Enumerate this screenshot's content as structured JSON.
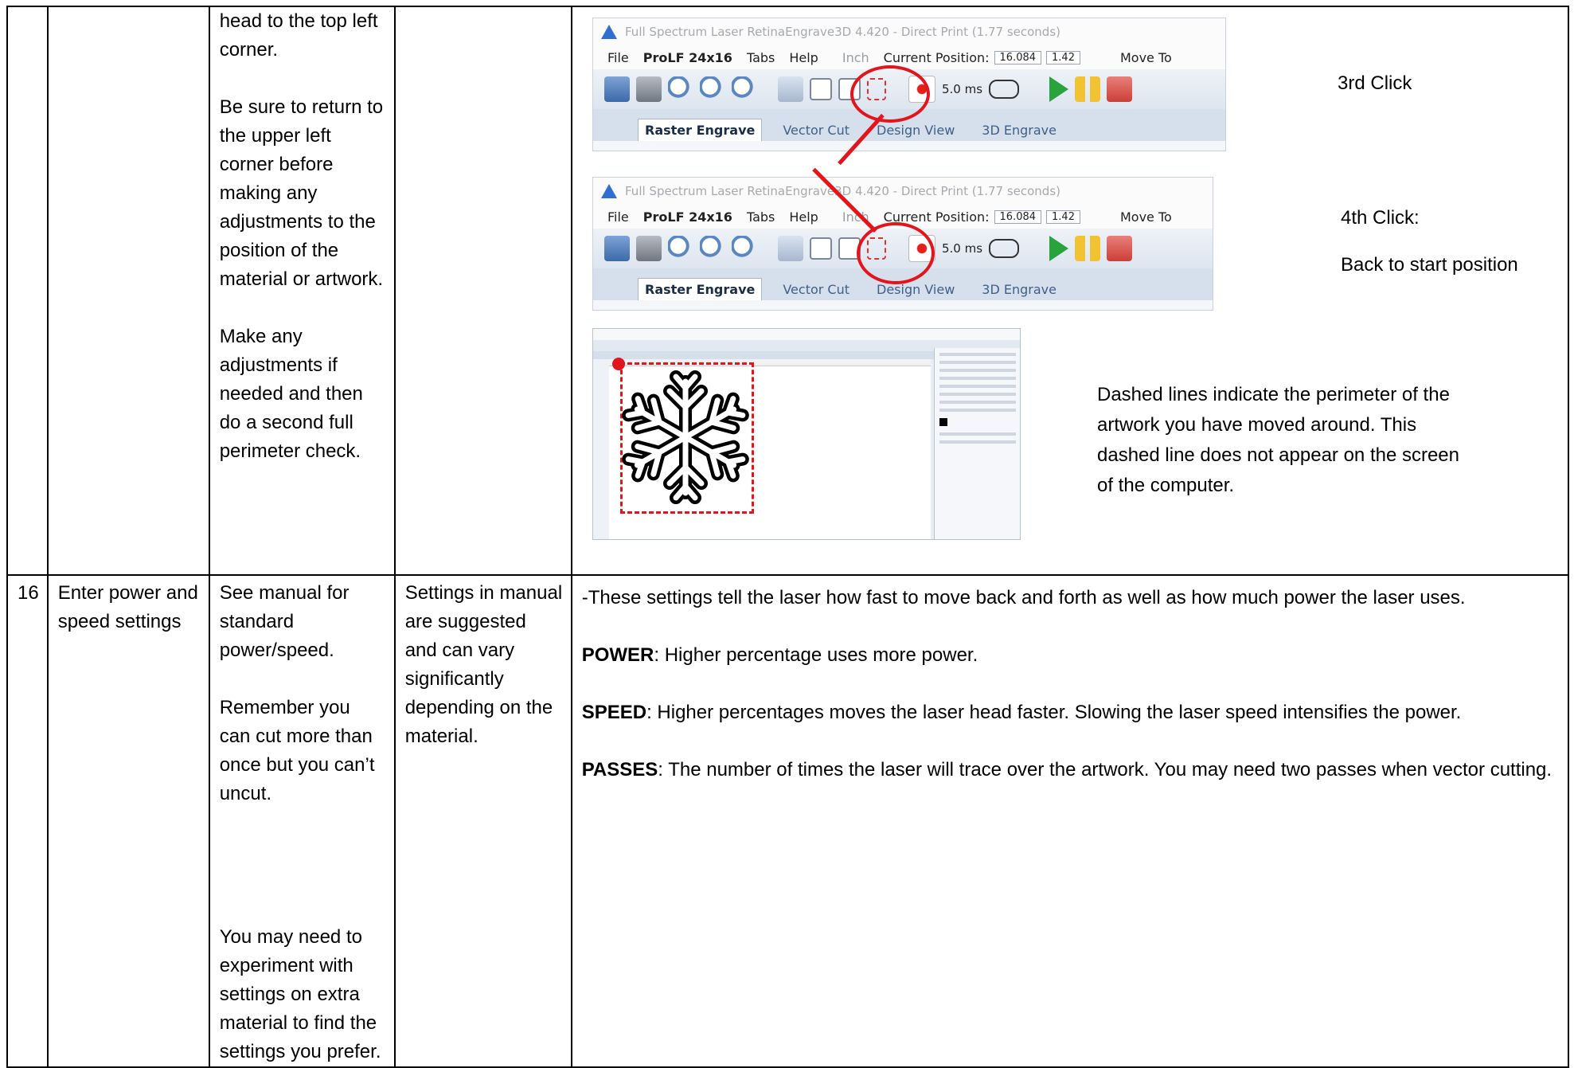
{
  "row_top": {
    "step_continued": [
      "head to the top left corner.",
      "Be sure to return to the upper left corner before making any adjustments to the position of the material or artwork.",
      "Make any adjustments if needed and then do a second full perimeter check."
    ],
    "callouts": {
      "third_click": "3rd Click",
      "fourth_click": "4th Click:",
      "back_to_start": "Back to start position",
      "dashed_note": "Dashed lines indicate the perimeter of the artwork you have moved around. This dashed line does not appear on the screen of the computer."
    },
    "screenshot": {
      "window_title": "Full Spectrum Laser RetinaEngrave3D 4.420 - Direct Print (1.77 seconds)",
      "menu": [
        "File",
        "ProLF 24x16",
        "Tabs",
        "Help"
      ],
      "unit": "Inch",
      "current_position_label": "Current Position:",
      "pos_x": "16.084",
      "pos_y": "1.42",
      "move_to": "Move To",
      "dwell": "5.0",
      "dwell_unit": "ms",
      "tabs": [
        "Raster Engrave",
        "Vector Cut",
        "Design View",
        "3D Engrave"
      ]
    }
  },
  "row_16": {
    "number": "16",
    "step": "Enter power and speed settings",
    "notes": [
      "See manual for standard power/speed.",
      "Remember you can cut more than once but you can’t uncut.",
      "You may need to experiment with settings on extra material to find the settings you prefer."
    ],
    "caution": "Settings in manual are suggested and can vary significantly depending on the material.",
    "intro": "-These settings tell the laser how fast to move back and forth as well as how much power the laser uses.",
    "power_term": "POWER",
    "power_text": ": Higher percentage uses more power.",
    "speed_term": "SPEED",
    "speed_text": ": Higher percentages moves the laser head faster. Slowing the laser speed intensifies the power.",
    "passes_term": "PASSES",
    "passes_text": ": The number of times the laser will trace over the artwork. You may need two passes when vector cutting."
  },
  "colors": {
    "highlight": "#e3141b",
    "play": "#29a33b",
    "border": "#000000"
  },
  "icons": [
    "folder-icon",
    "printer-icon",
    "zoom-in-icon",
    "zoom-out-icon",
    "zoom-fit-icon",
    "home-icon",
    "frame-icon",
    "dashed-frame-icon",
    "laser-icon",
    "play-icon",
    "pause-icon",
    "stop-icon",
    "snowflake-icon"
  ]
}
